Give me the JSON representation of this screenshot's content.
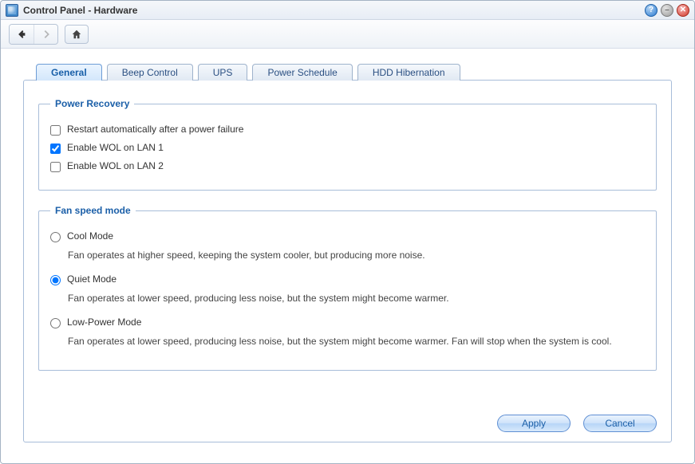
{
  "window": {
    "title": "Control Panel - Hardware"
  },
  "tabs": [
    {
      "label": "General",
      "active": true
    },
    {
      "label": "Beep Control",
      "active": false
    },
    {
      "label": "UPS",
      "active": false
    },
    {
      "label": "Power Schedule",
      "active": false
    },
    {
      "label": "HDD Hibernation",
      "active": false
    }
  ],
  "power_recovery": {
    "legend": "Power Recovery",
    "restart_auto": {
      "label": "Restart automatically after a power failure",
      "checked": false
    },
    "wol_lan1": {
      "label": "Enable WOL on LAN 1",
      "checked": true
    },
    "wol_lan2": {
      "label": "Enable WOL on LAN 2",
      "checked": false
    }
  },
  "fan_speed": {
    "legend": "Fan speed mode",
    "cool": {
      "label": "Cool Mode",
      "desc": "Fan operates at higher speed, keeping the system cooler, but producing more noise.",
      "selected": false
    },
    "quiet": {
      "label": "Quiet Mode",
      "desc": "Fan operates at lower speed, producing less noise, but the system might become warmer.",
      "selected": true
    },
    "low": {
      "label": "Low-Power Mode",
      "desc": "Fan operates at lower speed, producing less noise, but the system might become warmer. Fan will stop when the system is cool.",
      "selected": false
    }
  },
  "buttons": {
    "apply": "Apply",
    "cancel": "Cancel"
  }
}
